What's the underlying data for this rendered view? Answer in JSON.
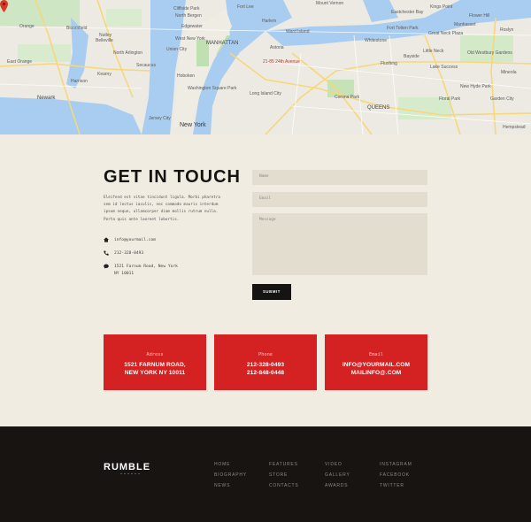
{
  "map": {
    "pin_label": "21-85 24th Avenue",
    "labels": [
      {
        "text": "North Bergen",
        "size": "sm"
      },
      {
        "text": "Cliffside Park",
        "size": "sm"
      },
      {
        "text": "Edgewater",
        "size": "sm"
      },
      {
        "text": "Orange",
        "size": "sm"
      },
      {
        "text": "Bloomfield",
        "size": "sm"
      },
      {
        "text": "Nutley",
        "size": "sm"
      },
      {
        "text": "Belleville",
        "size": "sm"
      },
      {
        "text": "North Arlington",
        "size": "sm"
      },
      {
        "text": "Kearny",
        "size": "sm"
      },
      {
        "text": "Harrison",
        "size": "sm"
      },
      {
        "text": "Newark",
        "size": "md"
      },
      {
        "text": "East Orange",
        "size": "sm"
      },
      {
        "text": "Secaucus",
        "size": "sm"
      },
      {
        "text": "Union City",
        "size": "sm"
      },
      {
        "text": "West New York",
        "size": "sm"
      },
      {
        "text": "Hoboken",
        "size": "sm"
      },
      {
        "text": "Jersey City",
        "size": "sm"
      },
      {
        "text": "New York",
        "size": "lg"
      },
      {
        "text": "MANHATTAN",
        "size": "md"
      },
      {
        "text": "Harlem",
        "size": "sm"
      },
      {
        "text": "Washington Square Park",
        "size": "sm"
      },
      {
        "text": "Ward Island",
        "size": "sm"
      },
      {
        "text": "Astoria",
        "size": "sm"
      },
      {
        "text": "Long Island City",
        "size": "sm"
      },
      {
        "text": "Corona Park",
        "size": "sm"
      },
      {
        "text": "QUEENS",
        "size": "md"
      },
      {
        "text": "Flushing",
        "size": "sm"
      },
      {
        "text": "Fort Totten Park",
        "size": "sm"
      },
      {
        "text": "Great Neck Plaza",
        "size": "sm"
      },
      {
        "text": "Manhasset",
        "size": "sm"
      },
      {
        "text": "Kings Point",
        "size": "sm"
      },
      {
        "text": "Flower Hill",
        "size": "sm"
      },
      {
        "text": "Roslyn",
        "size": "sm"
      },
      {
        "text": "Mineola",
        "size": "sm"
      },
      {
        "text": "Lake Success",
        "size": "sm"
      },
      {
        "text": "Old Westbury Gardens",
        "size": "sm"
      },
      {
        "text": "Floral Park",
        "size": "sm"
      },
      {
        "text": "New Hyde Park",
        "size": "sm"
      },
      {
        "text": "Garden City",
        "size": "sm"
      },
      {
        "text": "Hempstead",
        "size": "sm"
      },
      {
        "text": "Whitestone",
        "size": "sm"
      },
      {
        "text": "Eastchester Bay",
        "size": "sm"
      },
      {
        "text": "Fort Lee",
        "size": "sm"
      },
      {
        "text": "Little Neck",
        "size": "sm"
      },
      {
        "text": "Bayside",
        "size": "sm"
      },
      {
        "text": "Mount Vernon",
        "size": "sm"
      }
    ]
  },
  "contact": {
    "title": "GET IN TOUCH",
    "description": "Eleifend est vitae tincidunt ligula. Morbi pharetra sem id lectus iaculis, nec commodo mauris interdum ipsum neque, ullamcorper diam mollis rutrum nulla. Porta quis ante laoreet lobortis.",
    "email": "info@yourmail.com",
    "phone": "212-328-0493",
    "address": "1521 Farnum Road, New York\nNY 10011"
  },
  "form": {
    "name_placeholder": "Name",
    "email_placeholder": "Email",
    "message_placeholder": "Message",
    "submit_label": "SUBMIT"
  },
  "cards": [
    {
      "label": "Adress",
      "line1": "1521 FARNUM ROAD,",
      "line2": "NEW YORK NY 10011"
    },
    {
      "label": "Phone",
      "line1": "212-328-0493",
      "line2": "212-848-0448"
    },
    {
      "label": "Email",
      "line1": "INFO@YOURMAIL.COM",
      "line2": "MAILINFO@.COM"
    }
  ],
  "footer": {
    "logo": "RUMBLE",
    "columns": [
      [
        "HOME",
        "BIOGRAPHY",
        "NEWS"
      ],
      [
        "FEATURES",
        "STORE",
        "CONTACTS"
      ],
      [
        "VIDEO",
        "GALLERY",
        "AWARDS"
      ],
      [
        "INSTAGRAM",
        "FACEBOOK",
        "TWITTER"
      ]
    ]
  },
  "colors": {
    "accent_red": "#d42222",
    "background": "#f0ece2",
    "dark": "#171412"
  }
}
